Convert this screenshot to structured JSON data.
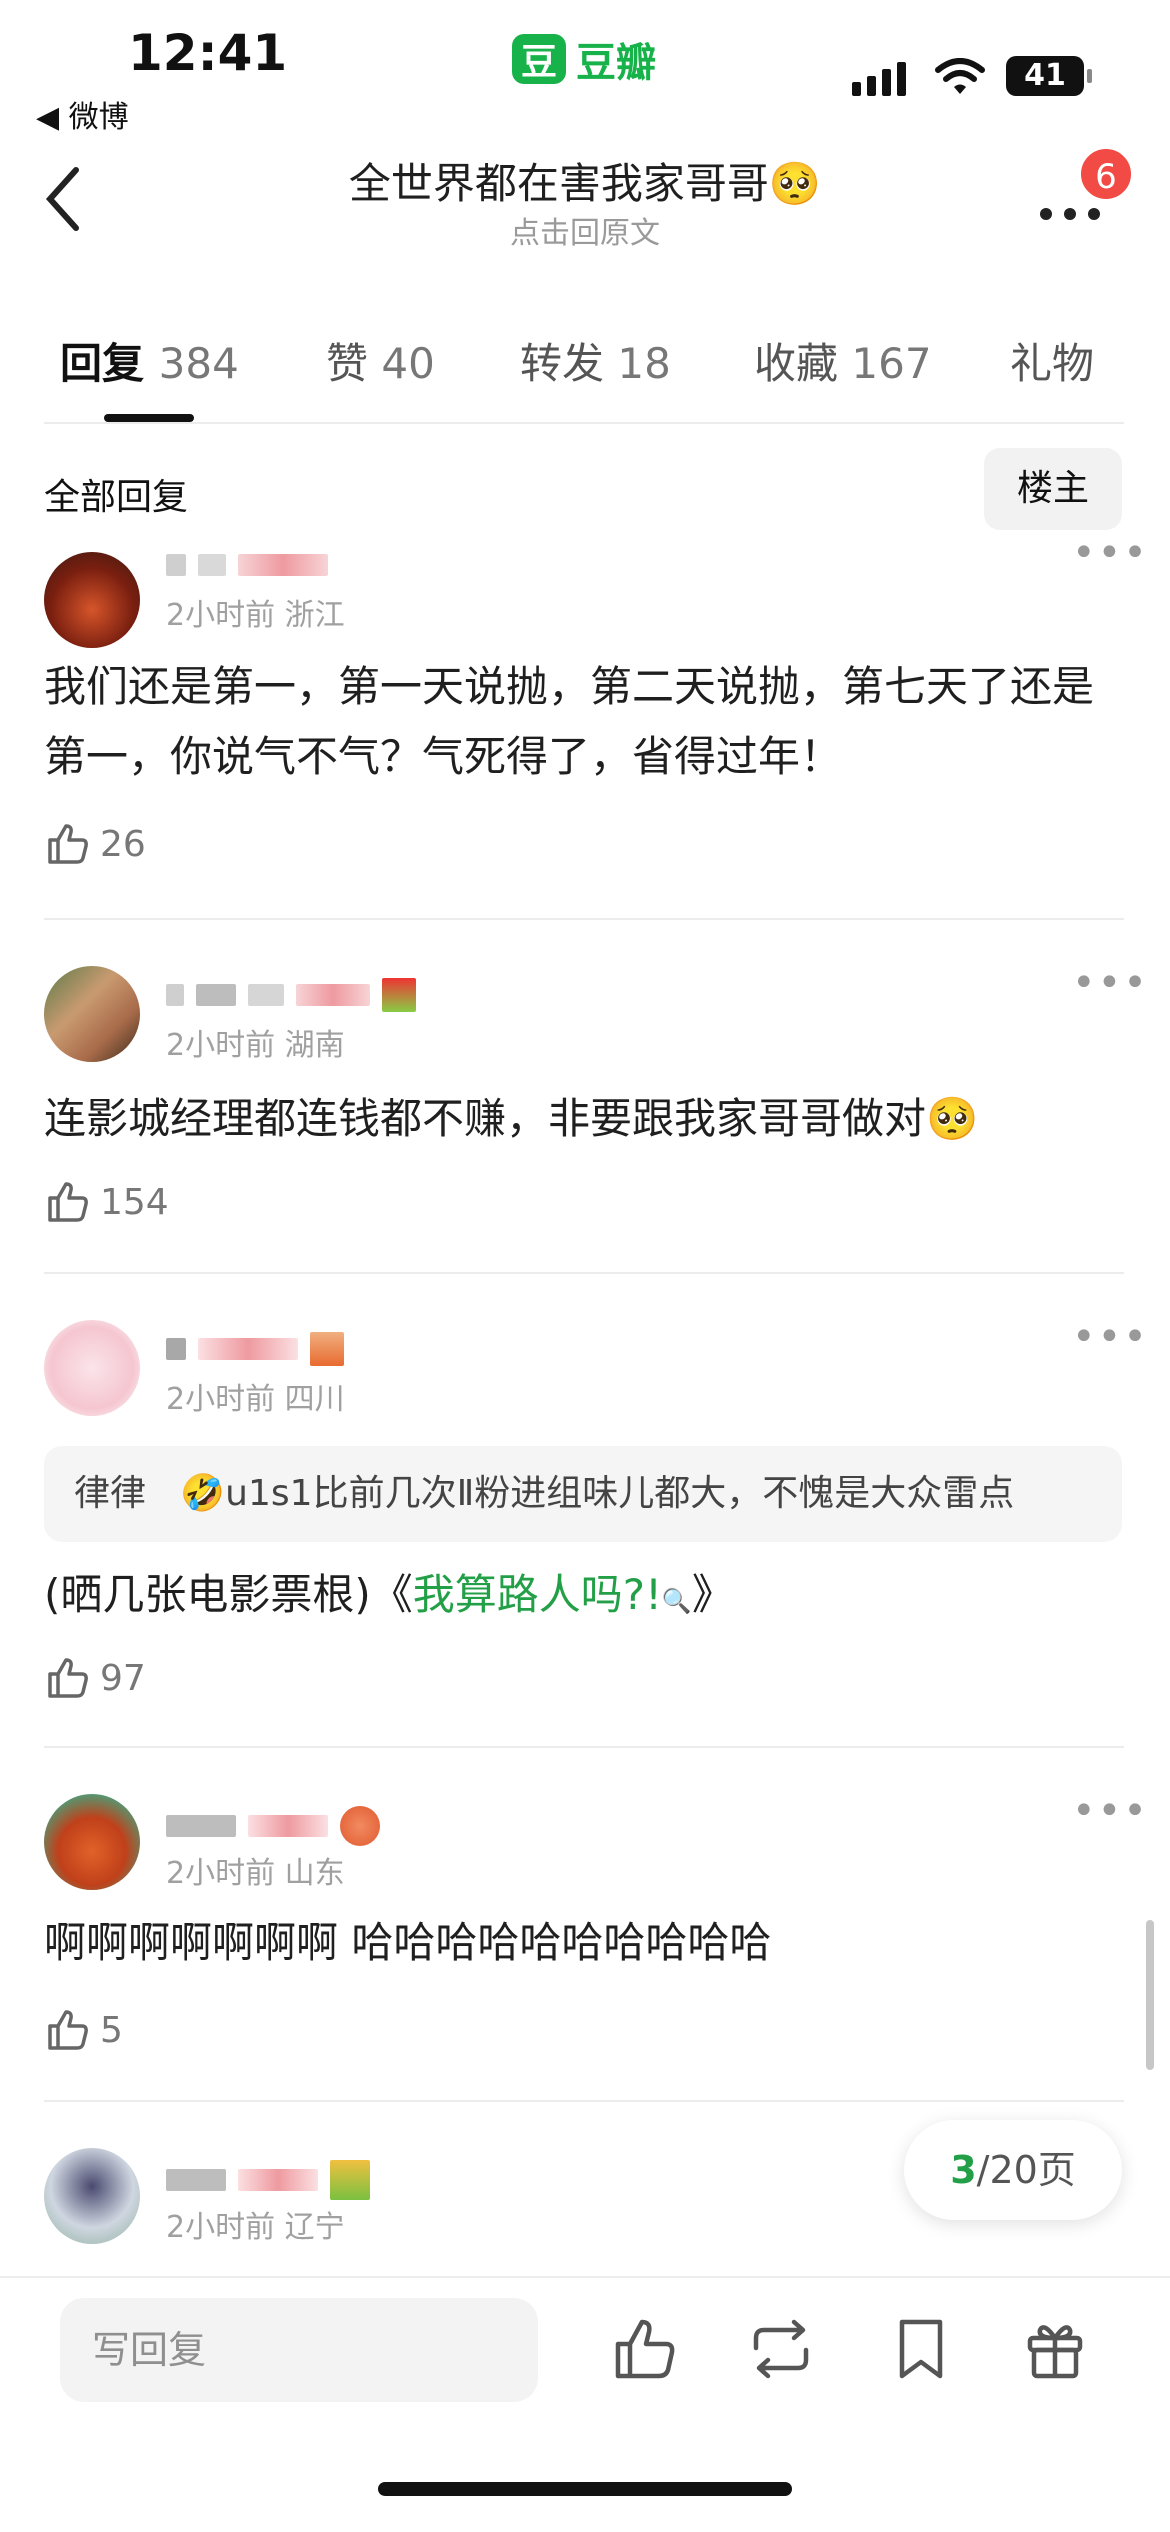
{
  "status_bar": {
    "time": "12:41",
    "back_app": "◀ 微博",
    "app_icon_char": "豆",
    "app_name": "豆瓣",
    "battery": "41"
  },
  "header": {
    "title": "全世界都在害我家哥哥🥺",
    "subtitle": "点击回原文",
    "notification_count": "6"
  },
  "tabs": [
    {
      "label": "回复",
      "count": "384"
    },
    {
      "label": "赞",
      "count": "40"
    },
    {
      "label": "转发",
      "count": "18"
    },
    {
      "label": "收藏",
      "count": "167"
    },
    {
      "label": "礼物",
      "count": ""
    }
  ],
  "filter": {
    "label": "全部回复",
    "op_button": "楼主"
  },
  "comments": [
    {
      "meta": "2小时前 浙江",
      "text": "我们还是第一，第一天说抛，第二天说抛，第七天了还是第一，你说气不气？气死得了，省得过年！",
      "likes": "26"
    },
    {
      "meta": "2小时前 湖南",
      "text": "连影城经理都连钱都不赚，非要跟我家哥哥做对🥺",
      "likes": "154"
    },
    {
      "meta": "2小时前 四川",
      "quote_author": "律律",
      "quote_text": "🤣u1s1比前几次Ⅱ粉进组味儿都大，不愧是大众雷点",
      "text_prefix": "(晒几张电影票根)《",
      "link_text": "我算路人吗?!",
      "link_icon": "🔍",
      "text_suffix": "》",
      "likes": "97"
    },
    {
      "meta": "2小时前 山东",
      "text": "啊啊啊啊啊啊啊   哈哈哈哈哈哈哈哈哈哈",
      "likes": "5"
    },
    {
      "meta": "2小时前 辽宁"
    }
  ],
  "pagination": {
    "current": "3",
    "total": "/20页"
  },
  "bottom_bar": {
    "reply_placeholder": "写回复"
  },
  "colors": {
    "accent_green": "#23a047",
    "badge_red": "#f24a45"
  }
}
